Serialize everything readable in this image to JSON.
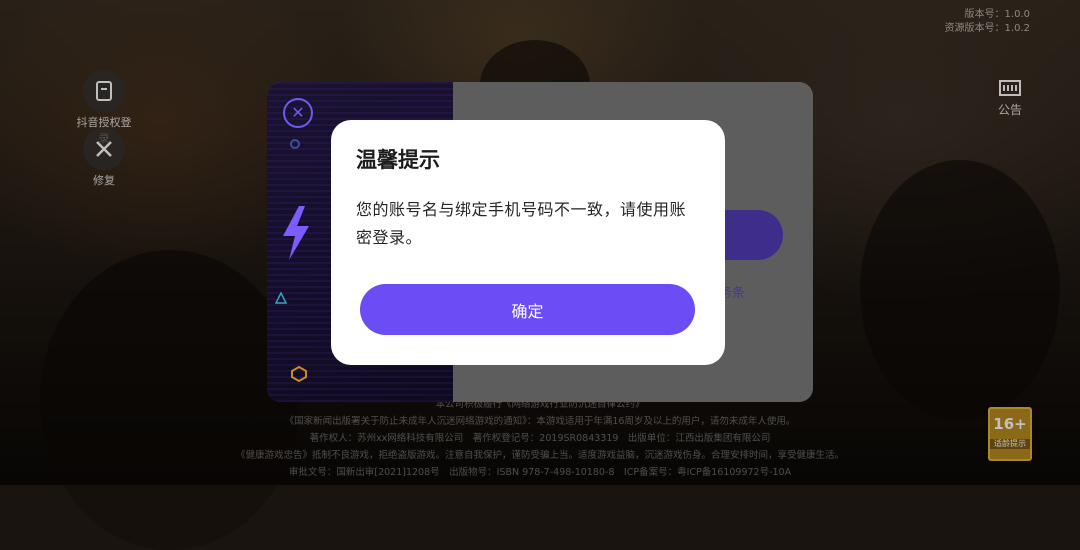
{
  "background": {
    "version_line1": "版本号：1.0.0",
    "version_line2": "资源版本号：1.0.2",
    "left_buttons": [
      {
        "label": "抖音授权登录"
      },
      {
        "label": "修复"
      }
    ],
    "notice_label": "公告",
    "footer_lines": [
      "本公司积极履行《网络游戏行业防沉迷自律公约》",
      "《国家新闻出版署关于防止未成年人沉迷网络游戏的通知》：本游戏适用于年满16周岁及以上的用户，请勿未成年人使用。",
      "著作权人：苏州xx网络科技有限公司　著作权登记号：2019SR0843319　出版单位：江西出版集团有限公司",
      "《健康游戏忠告》抵制不良游戏，拒绝盗版游戏。注意自我保护，谨防受骗上当。适度游戏益脑，沉迷游戏伤身。合理安排时间，享受健康生活。",
      "审批文号：国新出审[2021]1208号　出版物号：ISBN 978-7-498-10180-8　ICP备案号：粤ICP备16109972号-10A"
    ],
    "age_rating": "16+",
    "age_rating_label": "适龄提示"
  },
  "login_panel": {
    "close_symbol": "✕",
    "terms_text": "务条"
  },
  "dialog": {
    "title": "温馨提示",
    "message": "您的账号名与绑定手机号码不一致，请使用账密登录。",
    "confirm_label": "确定"
  },
  "colors": {
    "accent": "#6c4cf5",
    "dialog_bg": "#ffffff"
  }
}
